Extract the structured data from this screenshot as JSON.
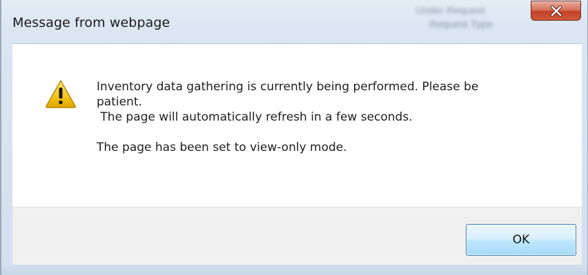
{
  "window": {
    "title": "Message from webpage",
    "close_icon": "close-icon",
    "background_text": [
      "Under Request",
      "Request Type"
    ]
  },
  "message": {
    "icon": "warning-icon",
    "lines": [
      "Inventory data gathering is currently being performed. Please be",
      "patient.",
      " The page will automatically refresh in a few seconds."
    ],
    "secondary": "The page has been set to view-only mode."
  },
  "footer": {
    "ok_label": "OK"
  },
  "colors": {
    "close_button": "#c9503a",
    "ok_border": "#3c7fb1",
    "warning_fill": "#f5c518"
  }
}
